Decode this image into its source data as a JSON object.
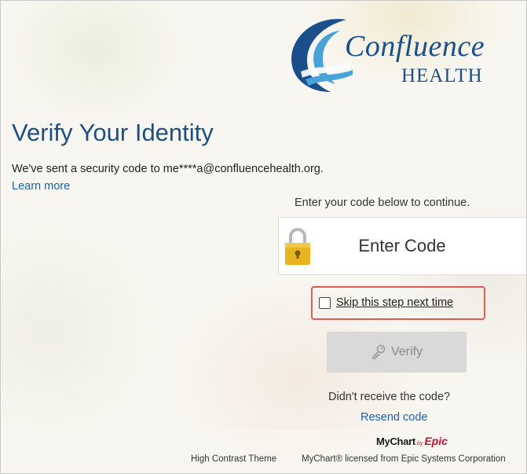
{
  "brand": {
    "logo_word": "Confluence",
    "logo_sub": "HEALTH",
    "colors": {
      "primary": "#1b4f8c",
      "light": "#4aa3d8"
    }
  },
  "page": {
    "title": "Verify Your Identity",
    "sent_text": "We've sent a security code to me****a@confluencehealth.org.",
    "learn_more": "Learn more"
  },
  "code": {
    "instruction": "Enter your code below to continue.",
    "placeholder": "Enter Code",
    "icon": "lock-icon"
  },
  "skip": {
    "label": "Skip this step next time",
    "checked": false,
    "highlight_color": "#e05a5a"
  },
  "verify": {
    "label": "Verify",
    "icon": "key-icon",
    "disabled": true
  },
  "resend": {
    "question": "Didn't receive the code?",
    "link": "Resend code"
  },
  "footer": {
    "mychart_name": "MyChart",
    "mychart_by": "by",
    "mychart_epic": "Epic",
    "high_contrast": "High Contrast Theme",
    "licensed": "MyChart® licensed from Epic Systems Corporation"
  }
}
